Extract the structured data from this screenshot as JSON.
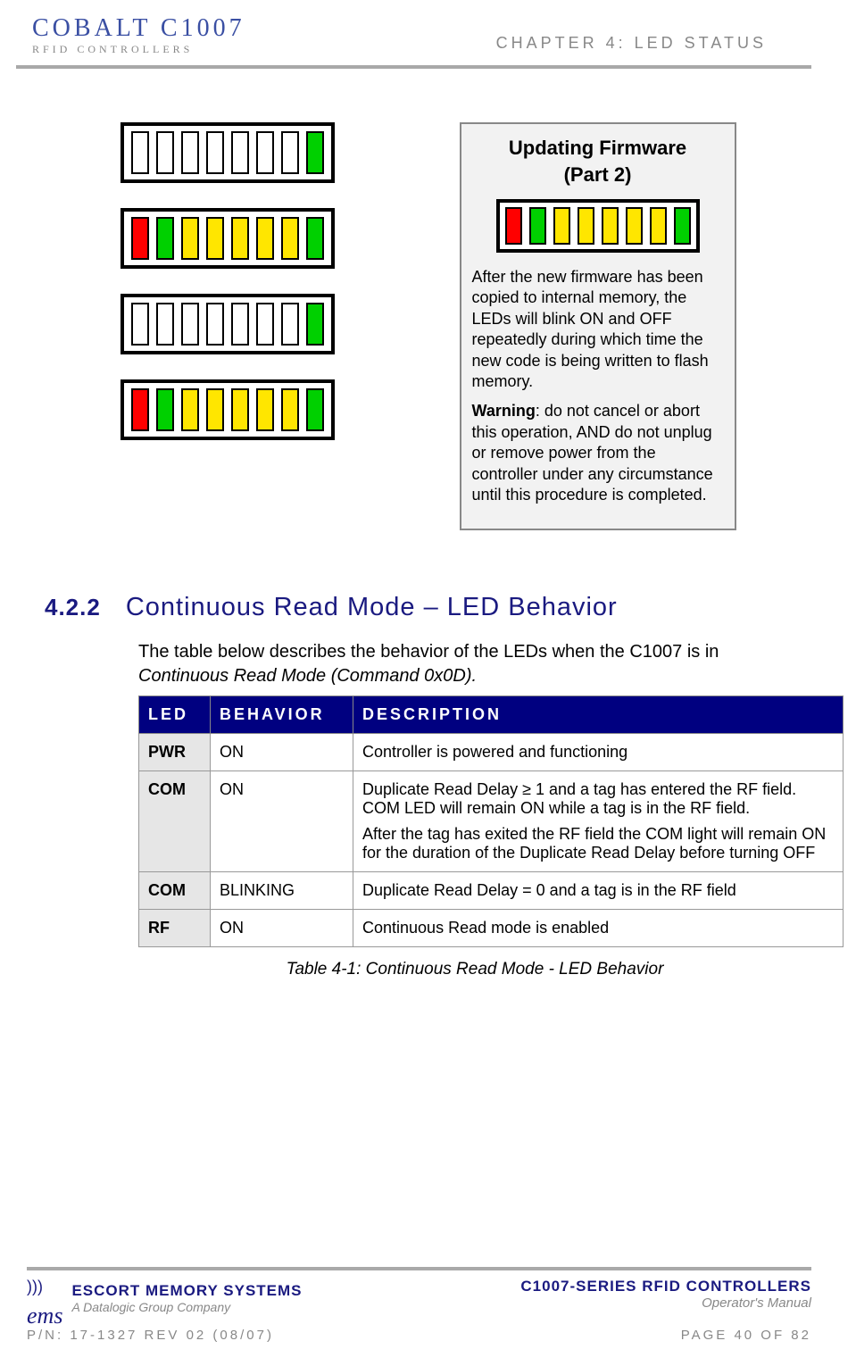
{
  "header": {
    "logo_line1": "COBALT  C1007",
    "logo_line2": "RFID CONTROLLERS",
    "chapter": "CHAPTER 4: LED STATUS"
  },
  "led_diagram": {
    "rows": [
      [
        "off",
        "off",
        "off",
        "off",
        "off",
        "off",
        "off",
        "green"
      ],
      [
        "red",
        "green",
        "yellow",
        "yellow",
        "yellow",
        "yellow",
        "yellow",
        "green"
      ],
      [
        "off",
        "off",
        "off",
        "off",
        "off",
        "off",
        "off",
        "green"
      ],
      [
        "red",
        "green",
        "yellow",
        "yellow",
        "yellow",
        "yellow",
        "yellow",
        "green"
      ]
    ]
  },
  "info_box": {
    "title": "Updating Firmware",
    "subtitle": "(Part 2)",
    "led_row": [
      "red",
      "green",
      "yellow",
      "yellow",
      "yellow",
      "yellow",
      "yellow",
      "green"
    ],
    "para1": "After the new firmware has been copied to internal memory, the LEDs will blink ON and OFF repeatedly during which time the new code is being written to flash memory.",
    "warning_label": "Warning",
    "para2": ": do not cancel or abort this operation, AND do not unplug or remove power from the controller under any circumstance until this procedure is completed."
  },
  "section": {
    "number": "4.2.2",
    "title": "Continuous Read Mode – LED Behavior",
    "intro_plain": "The table below describes the behavior of the LEDs when the C1007 is in ",
    "intro_italic": "Continuous Read Mode (Command 0x0D)."
  },
  "table": {
    "headers": {
      "led": "LED",
      "behavior": "BEHAVIOR",
      "description": "DESCRIPTION"
    },
    "rows": [
      {
        "led": "PWR",
        "behavior": "ON",
        "description": "Controller is powered and functioning"
      },
      {
        "led": "COM",
        "behavior": "ON",
        "description": "Duplicate Read Delay ≥ 1 and a tag has entered the RF field. COM LED will remain ON while a tag is in the RF field.\nAfter the tag has exited the RF field the COM light will remain ON for the duration of the Duplicate Read Delay before turning OFF"
      },
      {
        "led": "COM",
        "behavior": "BLINKING",
        "description": "Duplicate Read Delay = 0 and a tag is in the RF field"
      },
      {
        "led": "RF",
        "behavior": "ON",
        "description": "Continuous Read mode is enabled"
      }
    ],
    "caption": "Table 4-1: Continuous Read Mode - LED Behavior"
  },
  "footer": {
    "left_line1": "ESCORT MEMORY SYSTEMS",
    "left_line2": "A Datalogic Group Company",
    "ems_text": "ems",
    "right_line1": "C1007-SERIES RFID CONTROLLERS",
    "right_line2": "Operator's Manual",
    "pn": "P/N: 17-1327 REV 02 (08/07)",
    "page": "PAGE 40 OF 82"
  }
}
